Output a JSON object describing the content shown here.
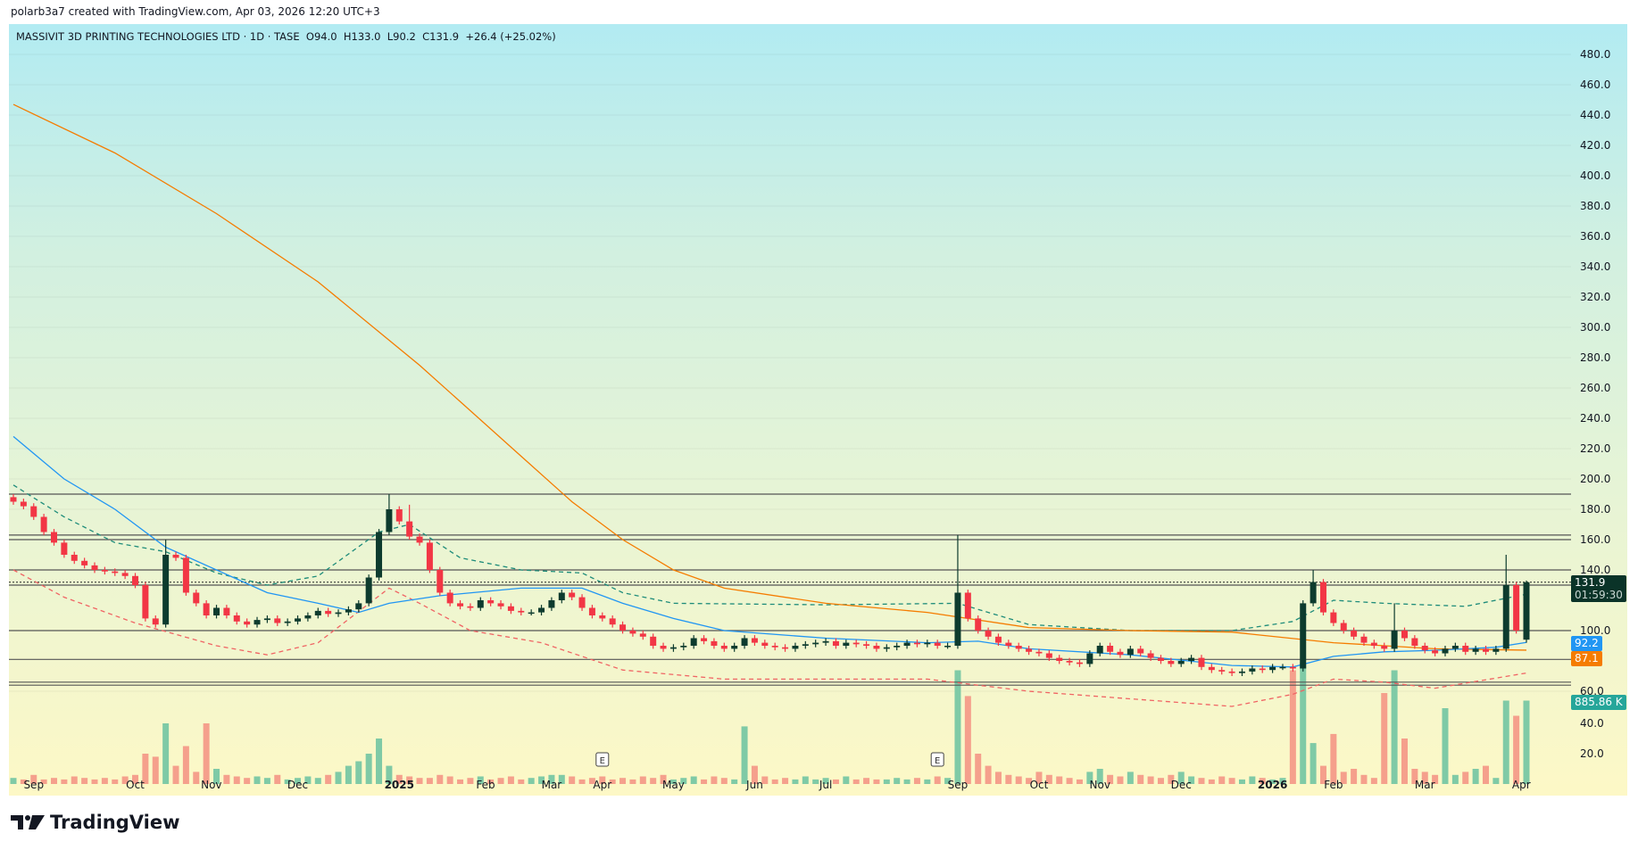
{
  "header": {
    "credit": "polarb3a7 created with TradingView.com, Apr 03, 2026 12:20 UTC+3"
  },
  "legend": {
    "text": "MASSIVIT 3D PRINTING TECHNOLOGIES LTD · 1D · TASE  O94.0  H133.0  L90.2  C131.9  +26.4 (+25.02%)"
  },
  "badges": {
    "price": "131.9",
    "countdown": "01:59:30",
    "ma_blue": "92.2",
    "ma_orange": "87.1",
    "volume": "885.86 K"
  },
  "logo": {
    "text": "TradingView"
  },
  "colors": {
    "up": "#0d3b2e",
    "down": "#f23645",
    "vol_up": "#7fcaa6",
    "vol_down": "#f5a08c",
    "ma_blue": "#2196f3",
    "ma_orange": "#f57c00",
    "band_upper": "#1e8c7a",
    "band_lower": "#f06464",
    "level": "#555555"
  },
  "chart_data": {
    "type": "candlestick",
    "title": "MASSIVIT 3D PRINTING TECHNOLOGIES LTD · 1D · TASE",
    "y_ticks": [
      480,
      460,
      440,
      420,
      400,
      380,
      360,
      340,
      320,
      300,
      280,
      260,
      240,
      220,
      200,
      180,
      160,
      140,
      100,
      60
    ],
    "volume_ticks": [
      40,
      20
    ],
    "x_labels": [
      {
        "i": 2,
        "t": "Sep"
      },
      {
        "i": 12,
        "t": "Oct"
      },
      {
        "i": 19.5,
        "t": "Nov"
      },
      {
        "i": 28,
        "t": "Dec"
      },
      {
        "i": 38,
        "t": "2025",
        "bold": true
      },
      {
        "i": 46.5,
        "t": "Feb"
      },
      {
        "i": 53,
        "t": "Mar"
      },
      {
        "i": 58,
        "t": "Apr"
      },
      {
        "i": 65,
        "t": "May"
      },
      {
        "i": 73,
        "t": "Jun"
      },
      {
        "i": 80,
        "t": "Jul"
      },
      {
        "i": 93,
        "t": "Sep"
      },
      {
        "i": 101,
        "t": "Oct"
      },
      {
        "i": 107,
        "t": "Nov"
      },
      {
        "i": 115,
        "t": "Dec"
      },
      {
        "i": 124,
        "t": "2026",
        "bold": true
      },
      {
        "i": 130,
        "t": "Feb"
      },
      {
        "i": 139,
        "t": "Mar"
      },
      {
        "i": 148.5,
        "t": "Apr"
      }
    ],
    "closes": [
      185,
      182,
      175,
      165,
      158,
      150,
      146,
      143,
      140,
      139,
      138,
      136,
      130,
      108,
      104,
      150,
      148,
      125,
      118,
      110,
      115,
      110,
      106,
      104,
      107,
      108,
      105,
      106,
      108,
      110,
      113,
      111,
      112,
      114,
      118,
      135,
      165,
      180,
      172,
      162,
      158,
      140,
      125,
      118,
      116,
      115,
      120,
      118,
      116,
      113,
      112,
      112,
      115,
      120,
      125,
      122,
      115,
      110,
      108,
      104,
      100,
      98,
      96,
      90,
      88,
      89,
      90,
      95,
      93,
      90,
      88,
      90,
      95,
      92,
      90,
      89,
      88,
      90,
      91,
      92,
      93,
      90,
      92,
      91,
      90,
      88,
      89,
      90,
      92,
      91,
      92,
      90,
      90,
      125,
      108,
      100,
      96,
      92,
      90,
      88,
      86,
      85,
      82,
      80,
      79,
      78,
      85,
      90,
      86,
      84,
      88,
      85,
      82,
      80,
      78,
      80,
      82,
      76,
      74,
      73,
      72,
      73,
      75,
      74,
      76,
      76,
      75,
      118,
      132,
      112,
      105,
      100,
      96,
      92,
      90,
      88,
      100,
      95,
      90,
      87,
      85,
      88,
      90,
      86,
      88,
      86,
      88,
      130,
      100,
      131.9
    ],
    "last_open": 94.0,
    "high_overrides": [
      [
        15,
        160
      ],
      [
        37,
        190
      ],
      [
        39,
        183
      ],
      [
        93,
        163
      ],
      [
        128,
        140
      ],
      [
        136,
        118
      ],
      [
        147,
        150
      ],
      [
        149,
        133
      ]
    ],
    "volumes_k": [
      4,
      3,
      6,
      3,
      4,
      3,
      5,
      4,
      3,
      4,
      3,
      5,
      6,
      20,
      18,
      40,
      12,
      25,
      8,
      40,
      10,
      6,
      5,
      4,
      5,
      4,
      6,
      3,
      4,
      5,
      4,
      6,
      8,
      12,
      15,
      20,
      30,
      12,
      6,
      5,
      4,
      4,
      6,
      5,
      3,
      4,
      5,
      3,
      4,
      5,
      3,
      4,
      5,
      6,
      6,
      5,
      3,
      4,
      5,
      3,
      4,
      3,
      5,
      4,
      6,
      3,
      4,
      5,
      3,
      5,
      4,
      3,
      38,
      12,
      5,
      3,
      4,
      3,
      5,
      3,
      4,
      3,
      5,
      3,
      4,
      3,
      3,
      4,
      3,
      4,
      3,
      5,
      4,
      75,
      58,
      20,
      12,
      8,
      6,
      5,
      4,
      8,
      6,
      5,
      4,
      3,
      8,
      10,
      6,
      5,
      8,
      6,
      5,
      4,
      6,
      8,
      5,
      4,
      3,
      5,
      4,
      3,
      5,
      4,
      3,
      4,
      75,
      80,
      27,
      12,
      33,
      8,
      10,
      6,
      4,
      60,
      75,
      30,
      10,
      8,
      6,
      50,
      6,
      8,
      10,
      12,
      4,
      55,
      45,
      55
    ],
    "earnings_markers": [
      {
        "i": 58,
        "t": "E"
      },
      {
        "i": 91,
        "t": "E"
      }
    ],
    "levels": [
      190,
      163,
      160,
      140,
      130,
      100,
      81,
      66,
      64
    ],
    "last_price_line": 131.9,
    "ma_orange": [
      [
        0,
        447
      ],
      [
        10,
        415
      ],
      [
        20,
        375
      ],
      [
        30,
        330
      ],
      [
        40,
        275
      ],
      [
        50,
        215
      ],
      [
        55,
        185
      ],
      [
        60,
        160
      ],
      [
        65,
        140
      ],
      [
        70,
        128
      ],
      [
        80,
        118
      ],
      [
        90,
        112
      ],
      [
        100,
        102
      ],
      [
        110,
        100
      ],
      [
        120,
        99
      ],
      [
        130,
        92
      ],
      [
        140,
        88
      ],
      [
        149,
        87.1
      ]
    ],
    "ma_blue": [
      [
        0,
        228
      ],
      [
        5,
        200
      ],
      [
        10,
        180
      ],
      [
        15,
        155
      ],
      [
        20,
        140
      ],
      [
        25,
        125
      ],
      [
        30,
        118
      ],
      [
        34,
        112
      ],
      [
        37,
        118
      ],
      [
        42,
        123
      ],
      [
        50,
        128
      ],
      [
        56,
        128
      ],
      [
        60,
        118
      ],
      [
        65,
        108
      ],
      [
        70,
        100
      ],
      [
        80,
        95
      ],
      [
        90,
        92
      ],
      [
        95,
        93
      ],
      [
        100,
        88
      ],
      [
        110,
        84
      ],
      [
        120,
        77
      ],
      [
        126,
        76
      ],
      [
        130,
        83
      ],
      [
        135,
        86
      ],
      [
        140,
        87
      ],
      [
        146,
        89
      ],
      [
        149,
        92.2
      ]
    ],
    "band_upper": [
      [
        0,
        196
      ],
      [
        5,
        175
      ],
      [
        10,
        158
      ],
      [
        15,
        152
      ],
      [
        20,
        138
      ],
      [
        25,
        130
      ],
      [
        30,
        136
      ],
      [
        36,
        165
      ],
      [
        39,
        170
      ],
      [
        44,
        148
      ],
      [
        50,
        140
      ],
      [
        56,
        138
      ],
      [
        60,
        125
      ],
      [
        65,
        118
      ],
      [
        80,
        117
      ],
      [
        93,
        118
      ],
      [
        100,
        104
      ],
      [
        110,
        100
      ],
      [
        120,
        100
      ],
      [
        126,
        106
      ],
      [
        130,
        120
      ],
      [
        135,
        118
      ],
      [
        143,
        116
      ],
      [
        149,
        124
      ]
    ],
    "band_lower": [
      [
        0,
        140
      ],
      [
        5,
        122
      ],
      [
        12,
        105
      ],
      [
        20,
        90
      ],
      [
        25,
        84
      ],
      [
        30,
        92
      ],
      [
        37,
        128
      ],
      [
        40,
        118
      ],
      [
        45,
        100
      ],
      [
        52,
        92
      ],
      [
        60,
        74
      ],
      [
        70,
        68
      ],
      [
        90,
        68
      ],
      [
        100,
        60
      ],
      [
        110,
        55
      ],
      [
        120,
        50
      ],
      [
        126,
        58
      ],
      [
        130,
        68
      ],
      [
        135,
        66
      ],
      [
        140,
        62
      ],
      [
        149,
        72
      ]
    ]
  }
}
